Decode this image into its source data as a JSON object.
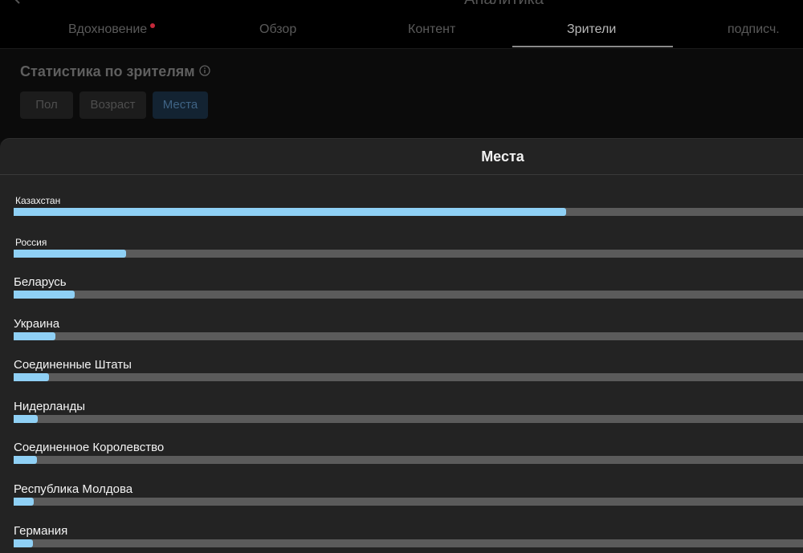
{
  "header": {
    "title": "Аналитика"
  },
  "tabs": [
    {
      "label": "Вдохновение",
      "has_dot": true
    },
    {
      "label": "Обзор"
    },
    {
      "label": "Контент"
    },
    {
      "label": "Зрители",
      "active": true
    },
    {
      "label": "подписч."
    }
  ],
  "stats": {
    "title": "Статистика по зрителям",
    "filters": [
      "Пол",
      "Возраст",
      "Места"
    ],
    "active_filter": "Места"
  },
  "sheet": {
    "title": "Места",
    "locations": [
      {
        "name": "Казахстан",
        "share": 0.7
      },
      {
        "name": "Россия",
        "share": 0.142
      },
      {
        "name": "Беларусь",
        "share": 0.077
      },
      {
        "name": "Украина",
        "share": 0.053
      },
      {
        "name": "Соединенные Штаты",
        "share": 0.045
      },
      {
        "name": "Нидерланды",
        "share": 0.031
      },
      {
        "name": "Соединенное Королевство",
        "share": 0.029
      },
      {
        "name": "Республика Молдова",
        "share": 0.025
      },
      {
        "name": "Германия",
        "share": 0.024
      }
    ]
  },
  "colors": {
    "bar_fill": "#8fd0f5",
    "bar_track": "#5b5b5b",
    "sheet_bg": "#232323",
    "notification_dot": "#c4283a"
  }
}
